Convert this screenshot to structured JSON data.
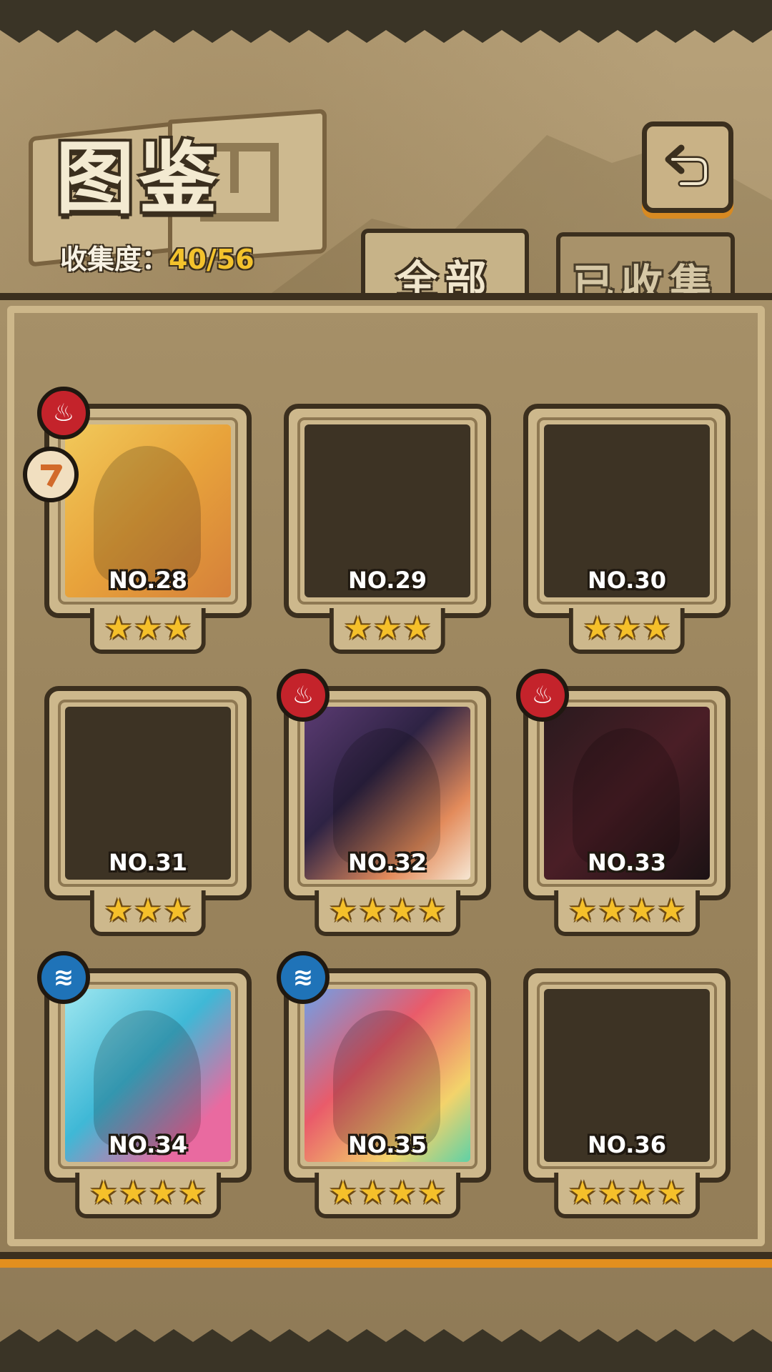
{
  "header": {
    "title": "图鉴",
    "progress_label": "收集度：",
    "progress_value": "40/56"
  },
  "tabs": [
    {
      "label": "全部",
      "active": true
    },
    {
      "label": "已收集",
      "active": false
    }
  ],
  "cards": [
    {
      "number": "NO.28",
      "stars": 3,
      "unlocked": true,
      "element": "fire-icon"
    },
    {
      "number": "NO.29",
      "stars": 3,
      "unlocked": false
    },
    {
      "number": "NO.30",
      "stars": 3,
      "unlocked": false
    },
    {
      "number": "NO.31",
      "stars": 3,
      "unlocked": false
    },
    {
      "number": "NO.32",
      "stars": 4,
      "unlocked": true,
      "element": "fire-icon"
    },
    {
      "number": "NO.33",
      "stars": 4,
      "unlocked": true,
      "element": "fire-icon"
    },
    {
      "number": "NO.34",
      "stars": 4,
      "unlocked": true,
      "element": "water-icon"
    },
    {
      "number": "NO.35",
      "stars": 4,
      "unlocked": true,
      "element": "water-icon"
    },
    {
      "number": "NO.36",
      "stars": 4,
      "unlocked": false
    }
  ],
  "icons": {
    "back": "back-arrow-icon",
    "fire": "fire-icon",
    "water": "water-icon",
    "star": "star-icon",
    "side_tag": "collect-tag-icon"
  },
  "colors": {
    "star": "#f5c02a",
    "fire_badge": "#c4232b",
    "water_badge": "#1f73b8",
    "progress_value": "#f3c22c",
    "accent_orange": "#e28f1e"
  }
}
